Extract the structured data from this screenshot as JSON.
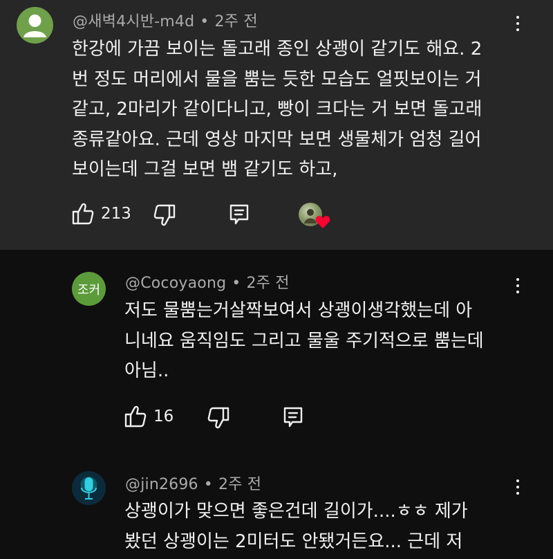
{
  "comments": [
    {
      "author": "@새벽4시반-m4d",
      "separator": "•",
      "time": "2주 전",
      "lines": [
        "한강에 가끔 보이는 돌고래 종인 상괭이 같기도 해요. 2",
        "번 정도 머리에서 물을 뿜는 듯한 모습도 얼핏보이는 거",
        "같고, 2마리가 같이다니고, 빵이 크다는 거 보면 돌고래",
        "종류같아요. 근데 영상 마지막 보면 생물체가 엄청 길어",
        "보이는데 그걸 보면 뱀 같기도 하고,"
      ],
      "likes": "213",
      "avatar_icon": "person-silhouette-icon",
      "avatar_color": "#6fa04a",
      "creator_heart_icon": "heart-icon",
      "heart_color": "#ff0033"
    },
    {
      "author": "@Cocoyaong",
      "separator": "•",
      "time": "2주 전",
      "avatar_text": "조커",
      "avatar_color": "#5c9b3a",
      "lines": [
        "저도 물뿜는거살짝보여서 상괭이생각했는데 아",
        "니네요 움직임도 그리고 물울 주기적으로 뿜는데",
        "아님.."
      ],
      "likes": "16"
    },
    {
      "author": "@jin2696",
      "separator": "•",
      "time": "2주 전",
      "avatar_icon": "microphone-icon",
      "avatar_color": "#0b2b3a",
      "lines": [
        "상괭이가 맞으면 좋은건데 길이가....ㅎㅎ 제가",
        "봤던 상괭이는 2미터도 안됐거든요... 근데 저"
      ]
    }
  ],
  "colors": {
    "top_background": "#272727",
    "page_background": "#0f0f0f",
    "meta_text": "#aaaaaa",
    "body_text": "#f1f1f1"
  },
  "icons": {
    "like": "thumbs-up-icon",
    "dislike": "thumbs-down-icon",
    "reply": "reply-icon",
    "more": "more-vertical-icon"
  }
}
